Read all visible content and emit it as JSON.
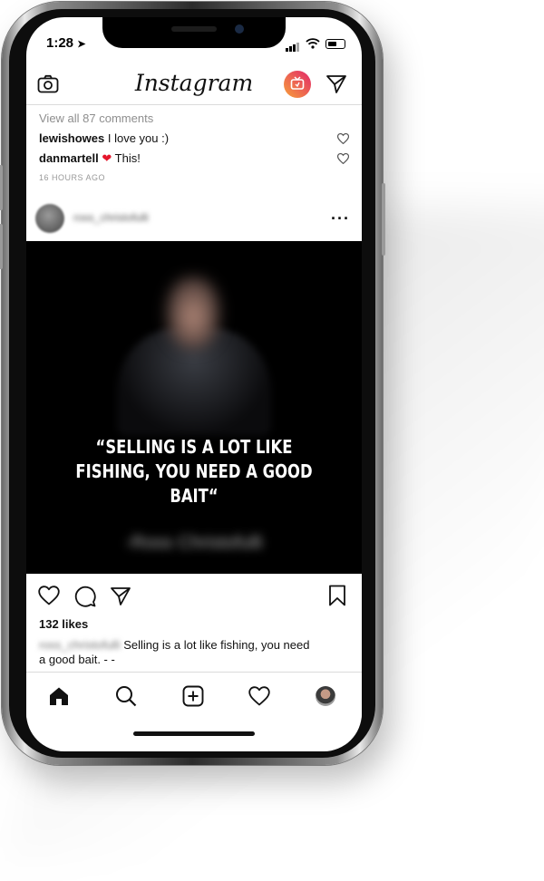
{
  "status_bar": {
    "time": "1:28"
  },
  "header": {
    "logo": "Instagram"
  },
  "prev_post": {
    "view_comments": "View all 87 comments",
    "comments": [
      {
        "user": "lewishowes",
        "text": "I love you :)"
      },
      {
        "user": "danmartell",
        "text": "❤️ This!"
      }
    ],
    "time_ago": "16 HOURS AGO"
  },
  "post": {
    "username": "ross_christofulli",
    "image_quote_line1": "“SELLING IS A LOT LIKE",
    "image_quote_line2": "FISHING, YOU NEED A GOOD BAIT“",
    "image_signature": "-Ross Christofulli",
    "likes": "132 likes",
    "caption_line1": "Selling is a lot like fishing, you need",
    "caption_line2": "a good bait. - -"
  },
  "colors": {
    "heart": "#e5162b",
    "igtv_start": "#f7a13a",
    "igtv_end": "#e2266a"
  },
  "icons": [
    "camera-icon",
    "igtv-icon",
    "direct-message-icon",
    "like-icon",
    "comment-icon",
    "share-icon",
    "bookmark-icon",
    "home-icon",
    "search-icon",
    "add-post-icon",
    "activity-icon",
    "profile-avatar"
  ]
}
